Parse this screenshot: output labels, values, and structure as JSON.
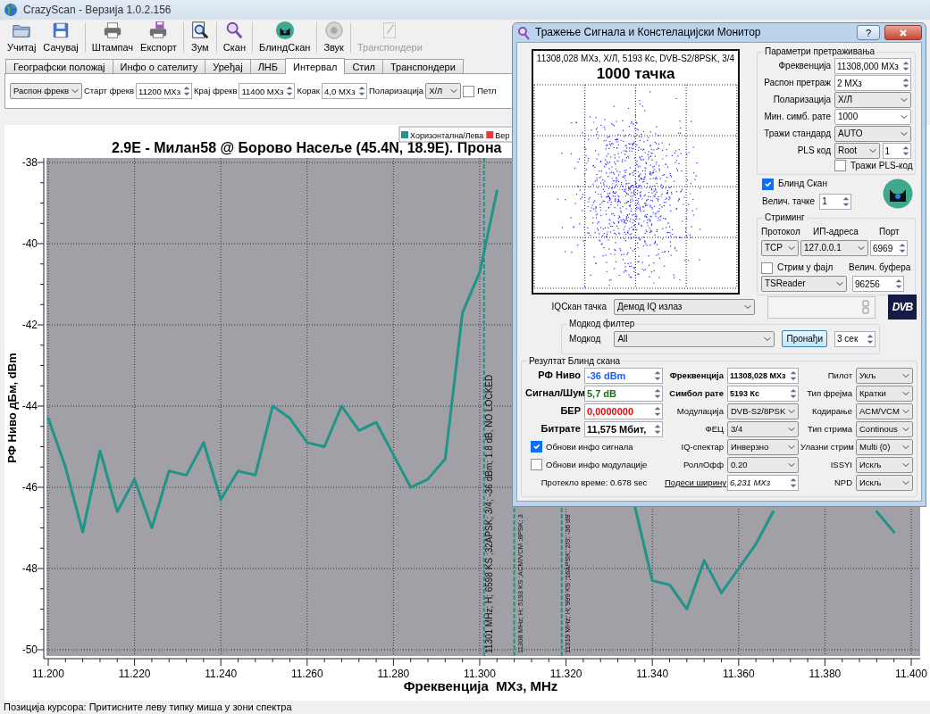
{
  "window": {
    "title": "CrazyScan - Верзија 1.0.2.156"
  },
  "toolbar": [
    [
      {
        "label": "Учитај",
        "disabled": false
      },
      {
        "label": "Сачувај",
        "disabled": false
      }
    ],
    [
      {
        "label": "Штампач",
        "disabled": false
      },
      {
        "label": "Експорт",
        "disabled": false
      }
    ],
    [
      {
        "label": "Зум",
        "disabled": false
      }
    ],
    [
      {
        "label": "Скан",
        "disabled": false
      }
    ],
    [
      {
        "label": "БлиндСкан",
        "disabled": false
      }
    ],
    [
      {
        "label": "Звук",
        "disabled": false
      }
    ],
    [
      {
        "label": "Транспондери",
        "disabled": true
      }
    ]
  ],
  "tabs": [
    {
      "label": "Географски положај",
      "selected": false
    },
    {
      "label": "Инфо о сателиту",
      "selected": false
    },
    {
      "label": "Уређај",
      "selected": false
    },
    {
      "label": "ЛНБ",
      "selected": false
    },
    {
      "label": "Интервал",
      "selected": true
    },
    {
      "label": "Стил",
      "selected": false
    },
    {
      "label": "Транспондери",
      "selected": false
    }
  ],
  "interval": [
    {
      "kind": "select",
      "value": "Распон фрекв"
    },
    {
      "kind": "label",
      "text": "Старт фрекв"
    },
    {
      "kind": "spin",
      "value": "11200 МХз"
    },
    {
      "kind": "label",
      "text": "Крај фрекв"
    },
    {
      "kind": "spin",
      "value": "11400 МХз"
    },
    {
      "kind": "label",
      "text": "Корак"
    },
    {
      "kind": "spin",
      "value": "4,0 МХз"
    },
    {
      "kind": "label",
      "text": "Поларизација"
    },
    {
      "kind": "select",
      "value": "Х/Л"
    },
    {
      "kind": "check",
      "label": "Петл",
      "checked": false
    }
  ],
  "chart": {
    "chart_data": {
      "type": "line",
      "title": "2.9E - Милан58 @ Борово Насеље (45.4N, 18.9E). Прона",
      "xlabel": "Фреквенција  МХз, MHz",
      "ylabel": "РФ Ниво дБм, dBm",
      "x": [
        11.2,
        11.204,
        11.208,
        11.212,
        11.216,
        11.22,
        11.224,
        11.228,
        11.232,
        11.236,
        11.24,
        11.244,
        11.248,
        11.252,
        11.256,
        11.26,
        11.264,
        11.268,
        11.272,
        11.276,
        11.28,
        11.284,
        11.288,
        11.292,
        11.296,
        11.3,
        11.304,
        11.308,
        11.312,
        11.316,
        11.32,
        11.324,
        11.328,
        11.332,
        11.336,
        11.34,
        11.344,
        11.348,
        11.352,
        11.356,
        11.36,
        11.364,
        11.368,
        11.372,
        11.376,
        11.38,
        11.384,
        11.388,
        11.392,
        11.396
      ],
      "series": [
        {
          "name": "Хоризонтална/Лева",
          "color": "#1f9488",
          "values": [
            -44.3,
            -45.5,
            -47.1,
            -45.1,
            -46.6,
            -45.8,
            -47.0,
            -45.6,
            -45.7,
            -44.9,
            -46.3,
            -45.6,
            -45.7,
            -44.0,
            -44.3,
            -44.9,
            -45.0,
            -44.0,
            -44.6,
            -44.4,
            -45.2,
            -46.0,
            -45.8,
            -45.3,
            -41.7,
            -40.7,
            -38.7,
            null,
            null,
            null,
            null,
            null,
            null,
            null,
            -46.5,
            -48.3,
            -48.4,
            -49.0,
            -47.8,
            -48.6,
            -48.0,
            -47.4,
            -46.6,
            null,
            null,
            null,
            null,
            null,
            -46.6,
            -47.1
          ]
        },
        {
          "name": "Вер",
          "color": "#e83a3a",
          "values": [
            null,
            null,
            null,
            null,
            null,
            null,
            null,
            null,
            null,
            null,
            null,
            null,
            null,
            null,
            null,
            null,
            null,
            null,
            null,
            null,
            null,
            null,
            null,
            null,
            null,
            null,
            null,
            null,
            null,
            null,
            null,
            null,
            null,
            null,
            null,
            null,
            null,
            null,
            null,
            null,
            null,
            null,
            null,
            null,
            null,
            null,
            null,
            null,
            null,
            null
          ]
        }
      ],
      "xlim": [
        11.2,
        11.4
      ],
      "ylim": [
        -50,
        -38
      ],
      "xticks": [
        {
          "value": 11.2,
          "label": "11.200"
        },
        {
          "value": 11.22,
          "label": "11.220"
        },
        {
          "value": 11.24,
          "label": "11.240"
        },
        {
          "value": 11.26,
          "label": "11.260"
        },
        {
          "value": 11.28,
          "label": "11.280"
        },
        {
          "value": 11.3,
          "label": "11.300"
        },
        {
          "value": 11.32,
          "label": "11.320"
        },
        {
          "value": 11.34,
          "label": "11.340"
        },
        {
          "value": 11.36,
          "label": "11.360"
        },
        {
          "value": 11.38,
          "label": "11.380"
        },
        {
          "value": 11.4,
          "label": "11.400"
        }
      ],
      "yticks": [
        -38,
        -40,
        -42,
        -44,
        -46,
        -48,
        -50
      ],
      "grid": true,
      "ref_lines": [
        {
          "axis": "x",
          "value": 11.301
        },
        {
          "axis": "x",
          "value": 11.308
        },
        {
          "axis": "x",
          "value": 11.319
        }
      ],
      "annotations": [
        "11301 MHz; H; 6598 KS ;32APSK; 3/4; -36 dBm; 1.8 dB, NO LOCKED",
        "11308 MHz; H; 5193 KS ;ACM/VCM ;8PSK; 3",
        "11319 MHz; H; 999 KS ;16APSK; 2/3; -36 dB"
      ]
    }
  },
  "status_bar": "Позиција курсора: Притисните леву типку миша у зони спектра",
  "dialog": {
    "title": "Тражење Сигнала и Констелацијски Монитор",
    "help": "?",
    "constellation": {
      "caption": "11308,028 МХз, Х/Л, 5193 Кс, DVB-S2/8PSK, 3/4",
      "heading": "1000 тачка"
    },
    "search": {
      "legend": "Параметри претраживања",
      "rows": [
        {
          "label": "Фреквенција",
          "controls": [
            {
              "kind": "spin",
              "value": "11308,000 МХз"
            }
          ]
        },
        {
          "label": "Распон претраж",
          "controls": [
            {
              "kind": "spin",
              "value": "2 МХз"
            }
          ]
        },
        {
          "label": "Поларизација",
          "controls": [
            {
              "kind": "select",
              "value": "Х/Л"
            }
          ]
        },
        {
          "label": "Мин. симб. рате",
          "controls": [
            {
              "kind": "combo",
              "value": "1000"
            }
          ]
        },
        {
          "label": "Тражи стандард",
          "controls": [
            {
              "kind": "select",
              "value": "AUTO"
            }
          ]
        },
        {
          "label": "PLS код",
          "controls": [
            {
              "kind": "select",
              "value": "Root"
            },
            {
              "kind": "spin",
              "value": "1"
            }
          ]
        }
      ],
      "pls_search": {
        "label": "Тражи PLS-код",
        "checked": false
      }
    },
    "blind_scan": {
      "label": "Блинд Скан",
      "checked": true
    },
    "point_size": {
      "label": "Велич. тачке",
      "value": "1"
    },
    "streaming": {
      "legend": "Стриминг",
      "protocol_label": "Протокол",
      "ip_label": "ИП-адреса",
      "port_label": "Порт",
      "protocol": "TCP",
      "ip": "127.0.0.1",
      "port": "6969",
      "to_file": {
        "label": "Стрим у фајл",
        "checked": false
      },
      "buffer_label": "Велич. буфера",
      "reader": "TSReader",
      "buffer": "96256"
    },
    "iq_point": {
      "label": "IQСкан тачка",
      "value": "Демод IQ излаз"
    },
    "dvb_logo": "DVB",
    "modcod_filter": {
      "legend": "Модкод филтер",
      "label": "Модкод",
      "value": "All",
      "button": "Пронађи",
      "timeout": "3 сек"
    },
    "result": {
      "legend": "Резултат Блинд скана",
      "readings": [
        {
          "label": "РФ Ниво",
          "value": "-36 dBm",
          "color": "#1a5cff"
        },
        {
          "label": "Сигнал/Шум",
          "value": "5,7 dB",
          "color": "#1a6e1a"
        },
        {
          "label": "БЕР",
          "value": "0,0000000",
          "color": "#ff0000"
        },
        {
          "label": "Битрате",
          "value": "11,575 Мбит,",
          "color": "#000000"
        }
      ],
      "options": [
        {
          "label": "Обнови инфо сигнала",
          "checked": true
        },
        {
          "label": "Обнови инфо модулације",
          "checked": false
        }
      ],
      "elapsed": "Протекло време: 0.678 sec",
      "details": [
        {
          "kind": "reading",
          "label": "Фреквенција",
          "value": "11308,028 МХз"
        },
        {
          "kind": "reading",
          "label": "Симбол рате",
          "value": "5193 Кс"
        },
        {
          "kind": "select",
          "label": "Модулација",
          "value": "DVB-S2/8PSK"
        },
        {
          "kind": "select",
          "label": "ФЕЦ",
          "value": "3/4"
        },
        {
          "kind": "select",
          "label": "IQ-спектар",
          "value": "Инверзно"
        },
        {
          "kind": "select",
          "label": "РоллОфф",
          "value": "0.20"
        },
        {
          "kind": "link",
          "label": "Подеси ширину",
          "value": "6,231 МХз"
        }
      ],
      "frame": [
        {
          "label": "Пилот",
          "value": "Укљ"
        },
        {
          "label": "Тип фрејма",
          "value": "Кратки"
        },
        {
          "label": "Кодирање",
          "value": "ACM/VCM"
        },
        {
          "label": "Тип стрима",
          "value": "Continous"
        },
        {
          "label": "Улазни стрим",
          "value": "Multi (0)"
        },
        {
          "label": "ISSYI",
          "value": "Искљ"
        },
        {
          "label": "NPD",
          "value": "Искљ"
        }
      ]
    }
  }
}
